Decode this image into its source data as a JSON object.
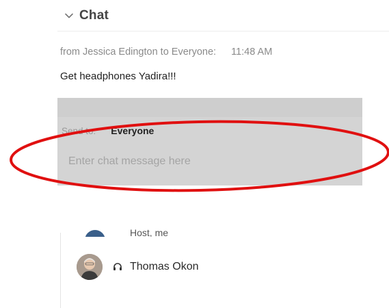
{
  "chat": {
    "title": "Chat",
    "toggle_icon": "chevron-down-icon"
  },
  "message": {
    "meta": "from Jessica Edington to Everyone:",
    "time": "11:48  AM",
    "text": "Get headphones Yadira!!!"
  },
  "compose": {
    "send_to_label": "Send to:",
    "send_to_value": "Everyone",
    "placeholder": "Enter chat message here"
  },
  "annotation": {
    "shape": "ellipse",
    "color": "#e01010"
  },
  "participants": {
    "partial_label": "Host, me",
    "items": [
      {
        "name": "Thomas Okon",
        "status_icon": "headset-icon"
      }
    ]
  }
}
